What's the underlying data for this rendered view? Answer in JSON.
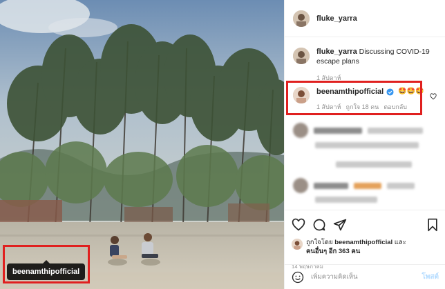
{
  "post": {
    "owner_username": "fluke_yarra",
    "caption_username": "fluke_yarra",
    "caption_text": "Discussing COVID-19 escape plans",
    "caption_time": "1 สัปดาห์",
    "photo_tag": "beenamthipofficial"
  },
  "highlighted_comment": {
    "username": "beenamthipofficial",
    "emoji": "🤩🤩🤩",
    "time": "1 สัปดาห์",
    "likes": "ถูกใจ 18 คน",
    "reply_label": "ตอบกลับ"
  },
  "likes_summary": {
    "prefix": "ถูกใจโดย",
    "username": "beenamthipofficial",
    "connector": "และ",
    "others": "คนอื่นๆ อีก 363 คน"
  },
  "post_date": "14 พฤษภาคม",
  "comment_input": {
    "placeholder": "เพิ่มความคิดเห็น",
    "post_label": "โพสต์"
  },
  "icons": {
    "like": "heart-icon",
    "comment": "comment-icon",
    "share": "share-icon",
    "save": "bookmark-icon",
    "emoji": "smiley-icon",
    "verified": "verified-badge-icon"
  },
  "colors": {
    "highlight_box": "#e0201f",
    "verified": "#3897f0",
    "post_button_disabled": "#b3dbff"
  }
}
